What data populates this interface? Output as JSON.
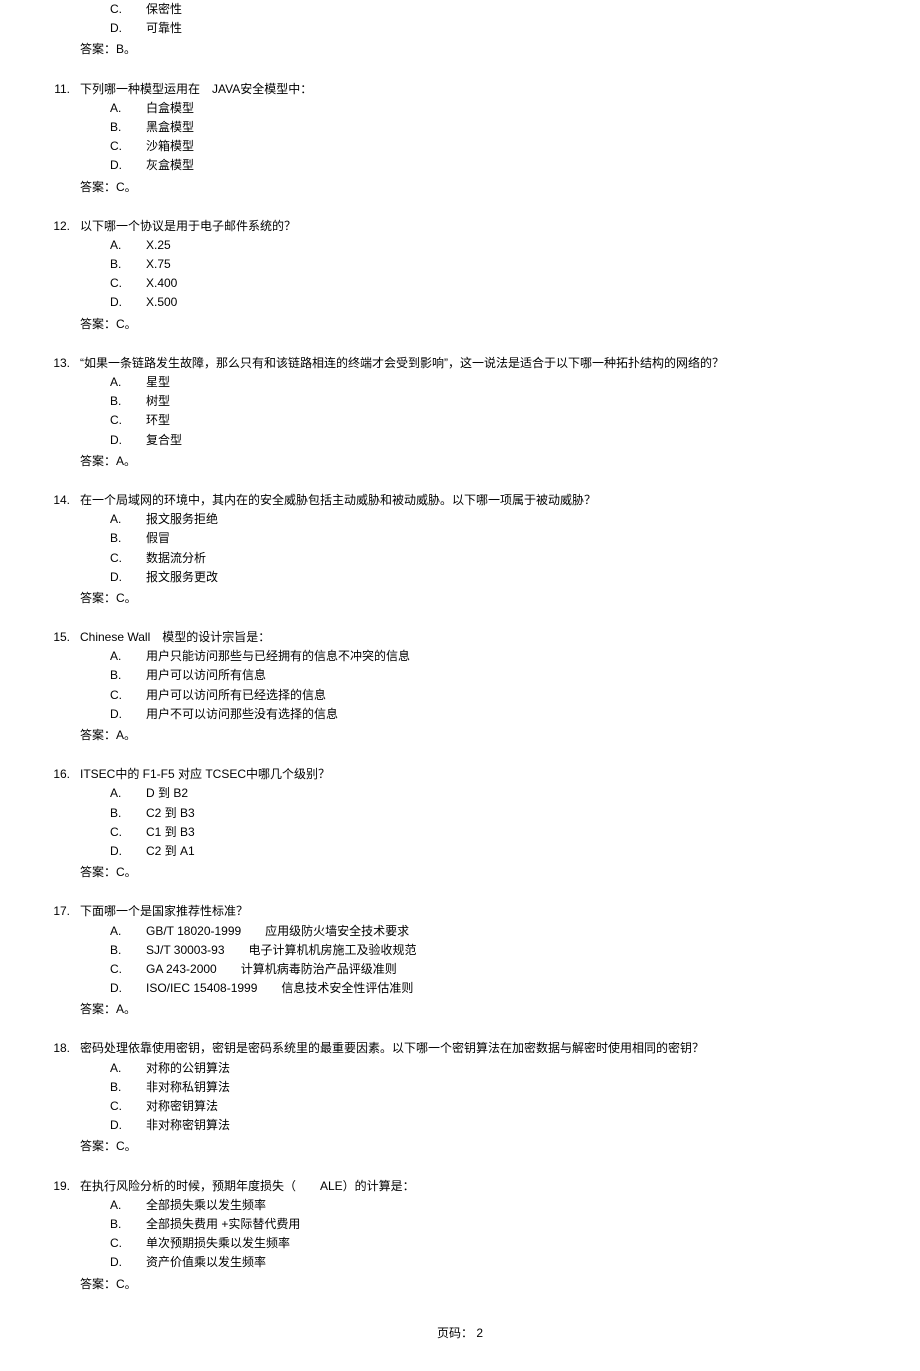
{
  "tail_options": [
    {
      "letter": "C.",
      "text": "保密性"
    },
    {
      "letter": "D.",
      "text": "可靠性"
    }
  ],
  "tail_answer": "答案：B。",
  "questions": [
    {
      "num": "11.",
      "stem": "下列哪一种模型运用在　JAVA安全模型中：",
      "options": [
        {
          "letter": "A.",
          "text": "白盒模型"
        },
        {
          "letter": "B.",
          "text": "黑盒模型"
        },
        {
          "letter": "C.",
          "text": "沙箱模型"
        },
        {
          "letter": "D.",
          "text": "灰盒模型"
        }
      ],
      "answer": "答案：C。"
    },
    {
      "num": "12.",
      "stem": "以下哪一个协议是用于电子邮件系统的？",
      "options": [
        {
          "letter": "A.",
          "text": "X.25"
        },
        {
          "letter": "B.",
          "text": "X.75"
        },
        {
          "letter": "C.",
          "text": "X.400"
        },
        {
          "letter": "D.",
          "text": "X.500"
        }
      ],
      "answer": "答案：C。"
    },
    {
      "num": "13.",
      "stem": "“如果一条链路发生故障，那么只有和该链路相连的终端才会受到影响”，这一说法是适合于以下哪一种拓扑结构的网络的？",
      "options": [
        {
          "letter": "A.",
          "text": "星型"
        },
        {
          "letter": "B.",
          "text": "树型"
        },
        {
          "letter": "C.",
          "text": "环型"
        },
        {
          "letter": "D.",
          "text": "复合型"
        }
      ],
      "answer": "答案：A。"
    },
    {
      "num": "14.",
      "stem": "在一个局域网的环境中，其内在的安全威胁包括主动威胁和被动威胁。以下哪一项属于被动威胁？",
      "options": [
        {
          "letter": "A.",
          "text": "报文服务拒绝"
        },
        {
          "letter": "B.",
          "text": "假冒"
        },
        {
          "letter": "C.",
          "text": "数据流分析"
        },
        {
          "letter": "D.",
          "text": "报文服务更改"
        }
      ],
      "answer": "答案：C。"
    },
    {
      "num": "15.",
      "stem": "Chinese Wall　模型的设计宗旨是：",
      "options": [
        {
          "letter": "A.",
          "text": "用户只能访问那些与已经拥有的信息不冲突的信息"
        },
        {
          "letter": "B.",
          "text": "用户可以访问所有信息"
        },
        {
          "letter": "C.",
          "text": "用户可以访问所有已经选择的信息"
        },
        {
          "letter": "D.",
          "text": "用户不可以访问那些没有选择的信息"
        }
      ],
      "answer": "答案：A。"
    },
    {
      "num": "16.",
      "stem": "ITSEC中的 F1-F5 对应 TCSEC中哪几个级别？",
      "options": [
        {
          "letter": "A.",
          "text": "D 到 B2"
        },
        {
          "letter": "B.",
          "text": "C2 到 B3"
        },
        {
          "letter": "C.",
          "text": "C1 到 B3"
        },
        {
          "letter": "D.",
          "text": "C2 到 A1"
        }
      ],
      "answer": "答案：C。"
    },
    {
      "num": "17.",
      "stem": "下面哪一个是国家推荐性标准？",
      "options": [
        {
          "letter": "A.",
          "text": "GB/T 18020-1999　　应用级防火墙安全技术要求"
        },
        {
          "letter": "B.",
          "text": "SJ/T 30003-93　　电子计算机机房施工及验收规范"
        },
        {
          "letter": "C.",
          "text": "GA 243-2000　　计算机病毒防治产品评级准则"
        },
        {
          "letter": "D.",
          "text": "ISO/IEC 15408-1999　　信息技术安全性评估准则"
        }
      ],
      "answer": "答案：A。"
    },
    {
      "num": "18.",
      "stem": "密码处理依靠使用密钥，密钥是密码系统里的最重要因素。以下哪一个密钥算法在加密数据与解密时使用相同的密钥？",
      "options": [
        {
          "letter": "A.",
          "text": "对称的公钥算法"
        },
        {
          "letter": "B.",
          "text": "非对称私钥算法"
        },
        {
          "letter": "C.",
          "text": "对称密钥算法"
        },
        {
          "letter": "D.",
          "text": "非对称密钥算法"
        }
      ],
      "answer": "答案：C。"
    },
    {
      "num": "19.",
      "stem": "在执行风险分析的时候，预期年度损失（　　ALE）的计算是：",
      "options": [
        {
          "letter": "A.",
          "text": "全部损失乘以发生频率"
        },
        {
          "letter": "B.",
          "text": "全部损失费用 +实际替代费用"
        },
        {
          "letter": "C.",
          "text": "单次预期损失乘以发生频率"
        },
        {
          "letter": "D.",
          "text": "资产价值乘以发生频率"
        }
      ],
      "answer": "答案：C。"
    }
  ],
  "footer": {
    "label": "页码：",
    "num": "2"
  }
}
